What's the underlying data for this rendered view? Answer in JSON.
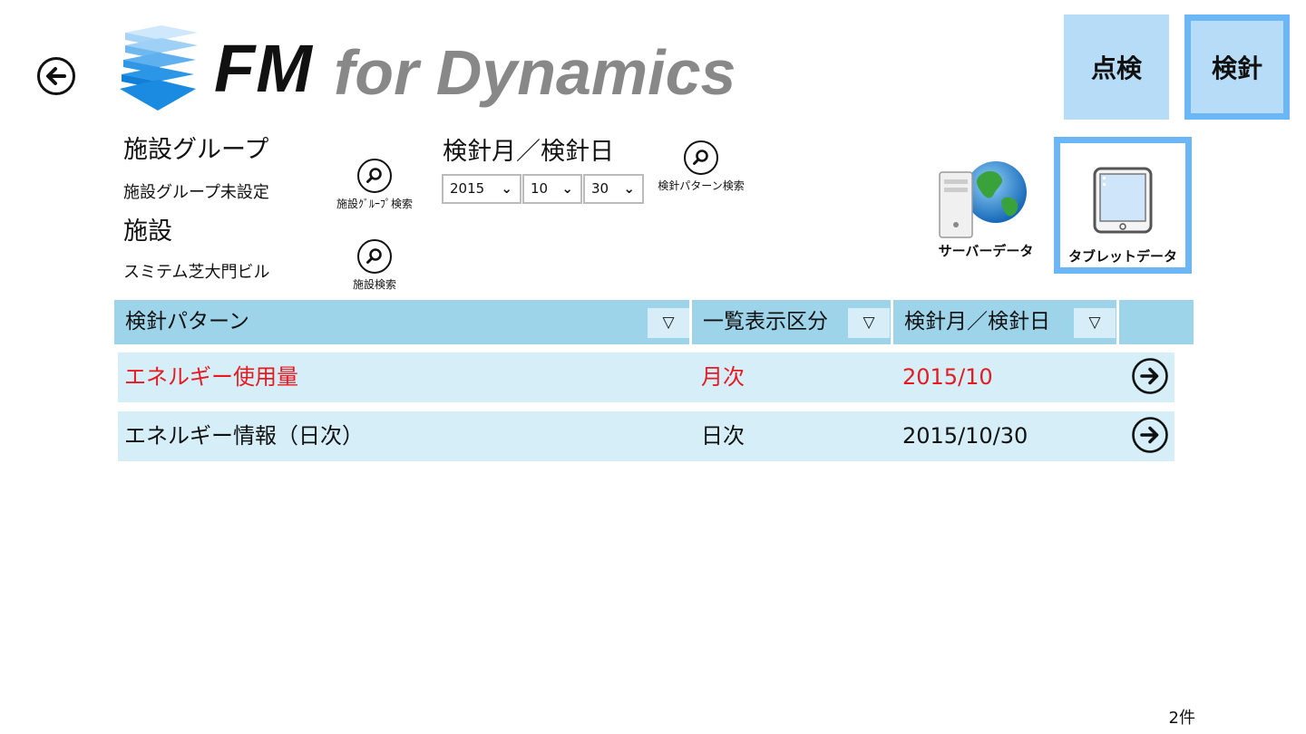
{
  "header": {
    "logo_main": "FM",
    "logo_sub": "for Dynamics",
    "modes": [
      {
        "label": "点検",
        "selected": false
      },
      {
        "label": "検針",
        "selected": true
      }
    ]
  },
  "facility": {
    "group_title": "施設グループ",
    "group_value": "施設グループ未設定",
    "group_search_label": "施設ｸﾞﾙｰﾌﾟ検索",
    "facility_title": "施設",
    "facility_value": "スミテム芝大門ビル",
    "facility_search_label": "施設検索"
  },
  "date": {
    "title": "検針月／検針日",
    "year": "2015",
    "month": "10",
    "day": "30",
    "pattern_search_label": "検針パターン検索"
  },
  "source": {
    "server_label": "サーバーデータ",
    "tablet_label": "タブレットデータ",
    "selected": "tablet"
  },
  "table": {
    "columns": [
      "検針パターン",
      "一覧表示区分",
      "検針月／検針日"
    ],
    "filter_glyph": "▽",
    "rows": [
      {
        "pattern": "エネルギー使用量",
        "type": "月次",
        "date": "2015/10",
        "highlight": true
      },
      {
        "pattern": "エネルギー情報（日次）",
        "type": "日次",
        "date": "2015/10/30",
        "highlight": false
      }
    ]
  },
  "footer": {
    "count": "2件"
  },
  "colors": {
    "accent_border": "#6bb7f5",
    "mode_bg": "#b6dcf7",
    "header_bg": "#9ed4ea",
    "row_bg": "#d5eef7",
    "highlight_text": "#e8191f"
  }
}
